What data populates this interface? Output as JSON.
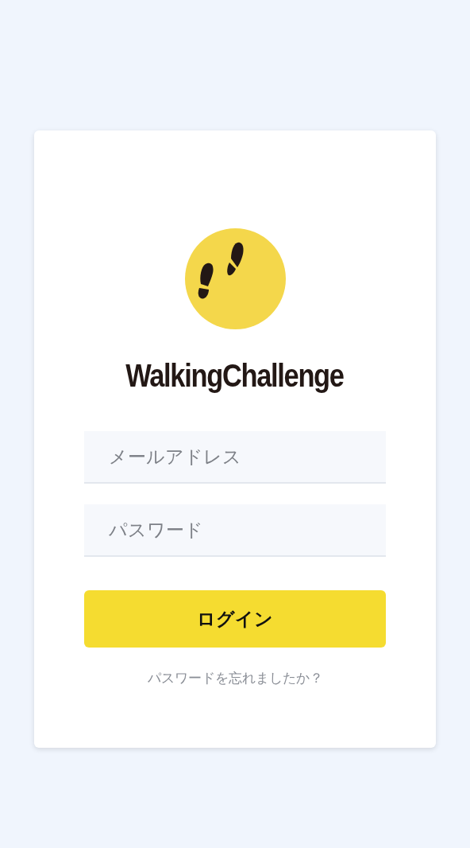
{
  "app_title": "WalkingChallenge",
  "fields": [
    {
      "placeholder": "メールアドレス"
    },
    {
      "placeholder": "パスワード"
    }
  ],
  "login_button": "ログイン",
  "forgot_link": "パスワードを忘れましたか？"
}
